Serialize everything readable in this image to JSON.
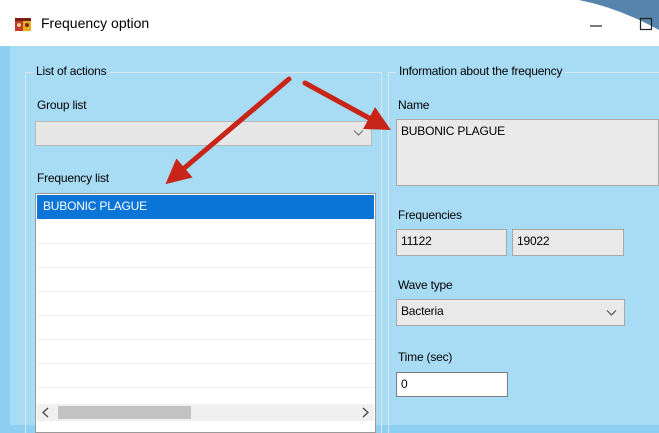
{
  "window": {
    "title": "Frequency option",
    "app_icon": "app-logo-icon",
    "controls": [
      "minimize-icon",
      "maximize-icon"
    ]
  },
  "actions": {
    "group_title": "List of actions",
    "group_list_label": "Group list",
    "group_list_value": "",
    "frequency_list_label": "Frequency list",
    "frequency_list": {
      "items": [
        "BUBONIC PLAGUE"
      ],
      "selected_index": 0
    }
  },
  "info": {
    "group_title": "Information about the frequency",
    "name_label": "Name",
    "name_value": "BUBONIC PLAGUE",
    "frequencies_label": "Frequencies",
    "frequencies": [
      "11122",
      "19022"
    ],
    "wave_type_label": "Wave type",
    "wave_type_value": "Bacteria",
    "time_label": "Time (sec)",
    "time_value": "0"
  },
  "colors": {
    "selection": "#0a75d6",
    "form_background": "#a8dcf5",
    "annotation_arrow": "#d0281c"
  }
}
